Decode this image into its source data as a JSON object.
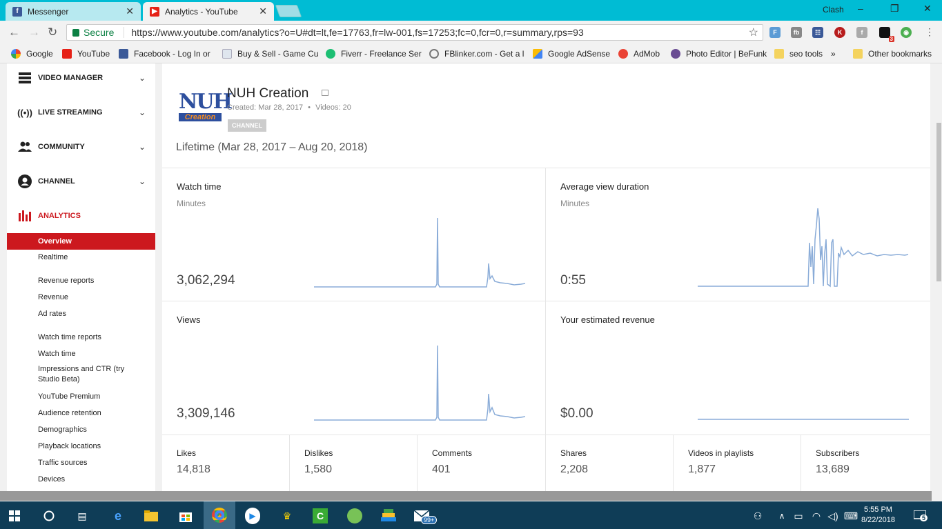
{
  "browser": {
    "tabs": [
      {
        "label": "Messenger",
        "active": false
      },
      {
        "label": "Analytics - YouTube",
        "active": true
      }
    ],
    "profile_name": "Clash",
    "secure_label": "Secure",
    "url": "https://www.youtube.com/analytics?o=U#dt=lt,fe=17763,fr=lw-001,fs=17253;fc=0,fcr=0,r=summary,rps=93",
    "extension_badge": "3",
    "bookmarks": [
      {
        "label": "Google",
        "icon": "google-icon"
      },
      {
        "label": "YouTube",
        "icon": "youtube-icon"
      },
      {
        "label": "Facebook - Log In or",
        "icon": "facebook-icon"
      },
      {
        "label": "Buy & Sell - Game Cu",
        "icon": "page-icon"
      },
      {
        "label": "Fiverr - Freelance Ser",
        "icon": "fiverr-icon"
      },
      {
        "label": "FBlinker.com - Get a l",
        "icon": "link-icon"
      },
      {
        "label": "Google AdSense",
        "icon": "adsense-icon"
      },
      {
        "label": "AdMob",
        "icon": "admob-icon"
      },
      {
        "label": "Photo Editor | BeFunk",
        "icon": "befunky-icon"
      },
      {
        "label": "seo tools",
        "icon": "folder-icon"
      }
    ],
    "bookmarks_more": "»",
    "other_bookmarks": "Other bookmarks"
  },
  "sidebar": {
    "sections": [
      {
        "label": "VIDEO MANAGER",
        "icon": "video-manager-icon"
      },
      {
        "label": "LIVE STREAMING",
        "icon": "live-streaming-icon"
      },
      {
        "label": "COMMUNITY",
        "icon": "community-icon"
      },
      {
        "label": "CHANNEL",
        "icon": "channel-icon"
      },
      {
        "label": "ANALYTICS",
        "icon": "analytics-icon"
      }
    ],
    "analytics_items": [
      "Overview",
      "Realtime",
      "Revenue reports",
      "Revenue",
      "Ad rates",
      "Watch time reports",
      "Watch time",
      "Impressions and CTR (try Studio Beta)",
      "YouTube Premium",
      "Audience retention",
      "Demographics",
      "Playback locations",
      "Traffic sources",
      "Devices"
    ]
  },
  "channel": {
    "logo_text_top": "NUH",
    "logo_text_bottom": "Creation",
    "name": "NUH Creation",
    "created": "Created: Mar 28, 2017",
    "separator": "•",
    "videos": "Videos: 20",
    "badge": "CHANNEL",
    "period": "Lifetime (Mar 28, 2017 – Aug 20, 2018)"
  },
  "cards": [
    {
      "title": "Watch time",
      "unit": "Minutes",
      "value": "3,062,294"
    },
    {
      "title": "Average view duration",
      "unit": "Minutes",
      "value": "0:55"
    },
    {
      "title": "Views",
      "unit": "",
      "value": "3,309,146"
    },
    {
      "title": "Your estimated revenue",
      "unit": "",
      "value": "$0.00"
    }
  ],
  "stats": [
    {
      "label": "Likes",
      "value": "14,818"
    },
    {
      "label": "Dislikes",
      "value": "1,580"
    },
    {
      "label": "Comments",
      "value": "401"
    },
    {
      "label": "Shares",
      "value": "2,208"
    },
    {
      "label": "Videos in playlists",
      "value": "1,877"
    },
    {
      "label": "Subscribers",
      "value": "13,689"
    }
  ],
  "taskbar": {
    "time": "5:55 PM",
    "date": "8/22/2018",
    "notification_count": "5",
    "mail_badge": "99+"
  },
  "colors": {
    "titlebar": "#00bcd4",
    "accent_red": "#cc181e",
    "sparkline": "#8aacd8",
    "taskbar": "#0f3d57"
  }
}
